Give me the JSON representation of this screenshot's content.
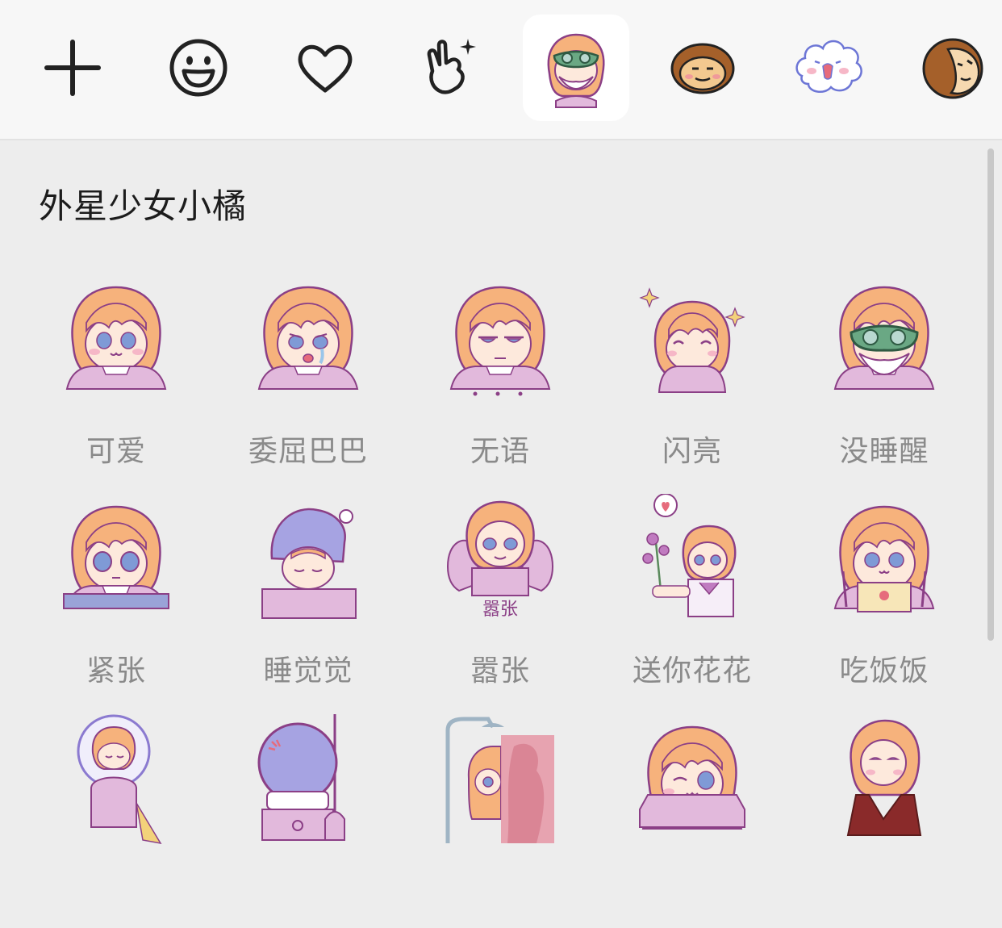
{
  "toolbar": {
    "tabs": [
      {
        "icon": "plus-icon"
      },
      {
        "icon": "smiley-face-icon"
      },
      {
        "icon": "heart-outline-icon"
      },
      {
        "icon": "hand-gesture-sparkle-icon"
      },
      {
        "icon": "orange-girl-pack-icon",
        "active": true
      },
      {
        "icon": "brown-face-pack-icon"
      },
      {
        "icon": "white-cloud-pack-icon"
      },
      {
        "icon": "brown-hair-face-pack-icon"
      }
    ]
  },
  "pack": {
    "title": "外星少女小橘",
    "stickers": [
      {
        "label": "可爱",
        "pose": "cute"
      },
      {
        "label": "委屈巴巴",
        "pose": "teary"
      },
      {
        "label": "无语",
        "pose": "speechless"
      },
      {
        "label": "闪亮",
        "pose": "sparkle"
      },
      {
        "label": "没睡醒",
        "pose": "sleepmask"
      },
      {
        "label": "紧张",
        "pose": "nervous"
      },
      {
        "label": "睡觉觉",
        "pose": "nightcap"
      },
      {
        "label": "嚣张",
        "pose": "arrogant",
        "caption": "嚣张"
      },
      {
        "label": "送你花花",
        "pose": "flowers"
      },
      {
        "label": "吃饭饭",
        "pose": "eating"
      },
      {
        "label": "",
        "pose": "astronaut"
      },
      {
        "label": "",
        "pose": "helmet"
      },
      {
        "label": "",
        "pose": "shower"
      },
      {
        "label": "",
        "pose": "wink"
      },
      {
        "label": "",
        "pose": "pose"
      }
    ]
  },
  "colors": {
    "hair": "#f6b27c",
    "outline": "#8b3f86",
    "skin": "#fde9dc",
    "cloth": "#e2b9dc",
    "eye": "#7f9ad6"
  }
}
